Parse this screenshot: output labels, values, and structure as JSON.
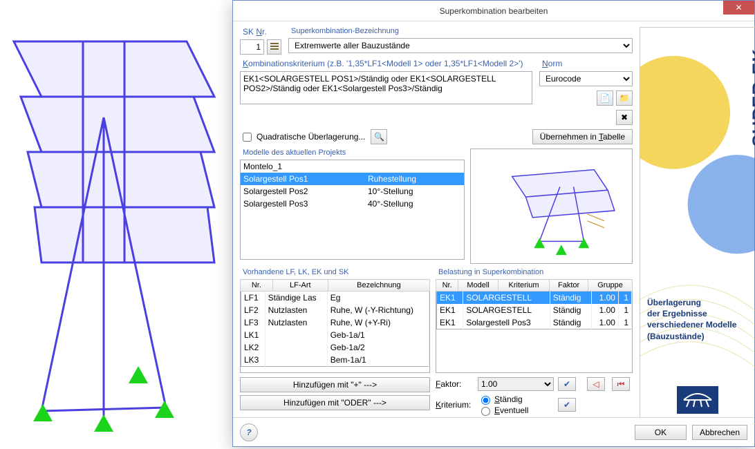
{
  "dialog": {
    "title": "Superkombination bearbeiten",
    "sk_nr_label_pre": "SK ",
    "sk_nr_label_u": "N",
    "sk_nr_label_post": "r.",
    "sk_nr_value": "1",
    "bez_label": "Superkombination-Bezeichnung",
    "bez_value": "Extremwerte aller Bauzustände",
    "komb_label_u": "K",
    "komb_label_rest": "ombinationskriterium (z.B. '1,35*LF1<Modell 1> oder 1,35*LF1<Modell 2>')",
    "komb_value": "EK1<SOLARGESTELL POS1>/Ständig oder EK1<SOLARGESTELL POS2>/Ständig oder EK1<Solargestell Pos3>/Ständig",
    "norm_label_u": "N",
    "norm_label_rest": "orm",
    "norm_value": "Eurocode",
    "quad_label": "Quadratische Überlagerung...",
    "uebernehmen_pre": "Ü",
    "uebernehmen_mid": "bernehmen in ",
    "uebernehmen_u": "T",
    "uebernehmen_post": "abelle",
    "modelle_label": "Modelle des aktuellen Projekts",
    "modelle": [
      {
        "name": "Montelo_1",
        "note": "",
        "selected": false
      },
      {
        "name": "Solargestell Pos1",
        "note": "Ruhestellung",
        "selected": true
      },
      {
        "name": "Solargestell Pos2",
        "note": "10°-Stellung",
        "selected": false
      },
      {
        "name": "Solargestell Pos3",
        "note": "40°-Stellung",
        "selected": false
      }
    ],
    "vorhandene_label": "Vorhandene LF, LK, EK und SK",
    "vorhandene_headers": [
      "Nr.",
      "LF-Art",
      "Bezeichnung"
    ],
    "vorhandene_rows": [
      [
        "LF1",
        "Ständige Las",
        "Eg"
      ],
      [
        "LF2",
        "Nutzlasten",
        "Ruhe, W (-Y-Richtung)"
      ],
      [
        "LF3",
        "Nutzlasten",
        "Ruhe, W (+Y-Ri)"
      ],
      [
        "LK1",
        "",
        "Geb-1a/1"
      ],
      [
        "LK2",
        "",
        "Geb-1a/2"
      ],
      [
        "LK3",
        "",
        "Bem-1a/1"
      ]
    ],
    "add_plus": "Hinzufügen mit  \"+\"  --->",
    "add_oder": "Hinzufügen mit \"ODER\" --->",
    "belastung_label": "Belastung in Superkombination",
    "belastung_headers": [
      "Nr.",
      "Modell",
      "Kriterium",
      "Faktor",
      "Gruppe"
    ],
    "belastung_rows": [
      {
        "cells": [
          "EK1",
          "SOLARGESTELL",
          "Ständig",
          "1.00",
          "1"
        ],
        "selected": true
      },
      {
        "cells": [
          "EK1",
          "SOLARGESTELL",
          "Ständig",
          "1.00",
          "1"
        ],
        "selected": false
      },
      {
        "cells": [
          "EK1",
          "Solargestell Pos3",
          "Ständig",
          "1.00",
          "1"
        ],
        "selected": false
      }
    ],
    "faktor_label_u": "F",
    "faktor_label_rest": "aktor:",
    "faktor_value": "1.00",
    "kriterium_label_u": "K",
    "kriterium_label_rest": "riterium:",
    "kriterium_opts": {
      "staendig_u": "S",
      "staendig_rest": "tändig",
      "eventuell_u": "E",
      "eventuell_rest": "ventuell"
    },
    "help_icon": "?",
    "ok": "OK",
    "cancel": "Abbrechen"
  },
  "brand": {
    "name": "SUPER-EK",
    "desc1": "Überlagerung",
    "desc2": "der Ergebnisse",
    "desc3": "verschiedener Modelle",
    "desc4": "(Bauzustände)"
  }
}
